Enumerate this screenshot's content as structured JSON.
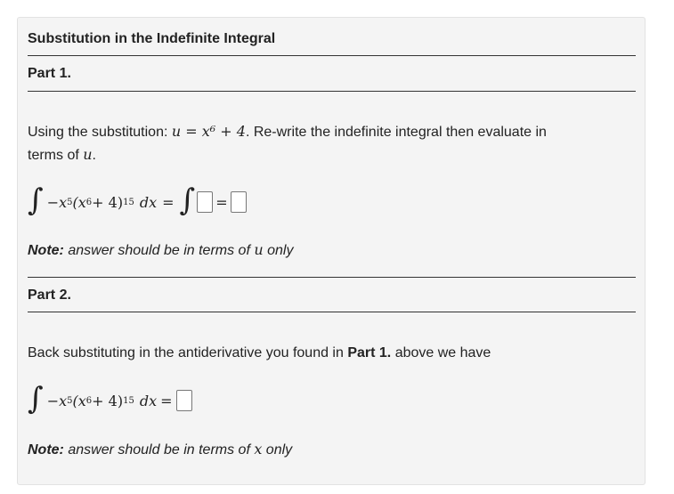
{
  "title": "Substitution in the Indefinite Integral",
  "part1": {
    "heading": "Part 1.",
    "intro_prefix": "Using the substitution: ",
    "substitution": "u = x⁶ + 4",
    "intro_suffix": ". Re-write the indefinite integral then evaluate in",
    "intro_line2_prefix": "terms of ",
    "intro_line2_var": "u",
    "intro_line2_suffix": ".",
    "integrand_coef": "−x",
    "integrand_coef_exp": "5",
    "integrand_inner": "(x",
    "inner_exp": "6",
    "inner_rest": " + 4)",
    "outer_exp": "15",
    "dx": "dx",
    "note_label": "Note:",
    "note_text": " answer should be in terms of ",
    "note_var": "u",
    "note_end": " only"
  },
  "part2": {
    "heading": "Part 2.",
    "intro_prefix": "Back substituting in the antiderivative you found in ",
    "intro_bold": "Part 1.",
    "intro_suffix": " above we have",
    "note_label": "Note:",
    "note_text": " answer should be in terms of ",
    "note_var": "x",
    "note_end": " only"
  }
}
